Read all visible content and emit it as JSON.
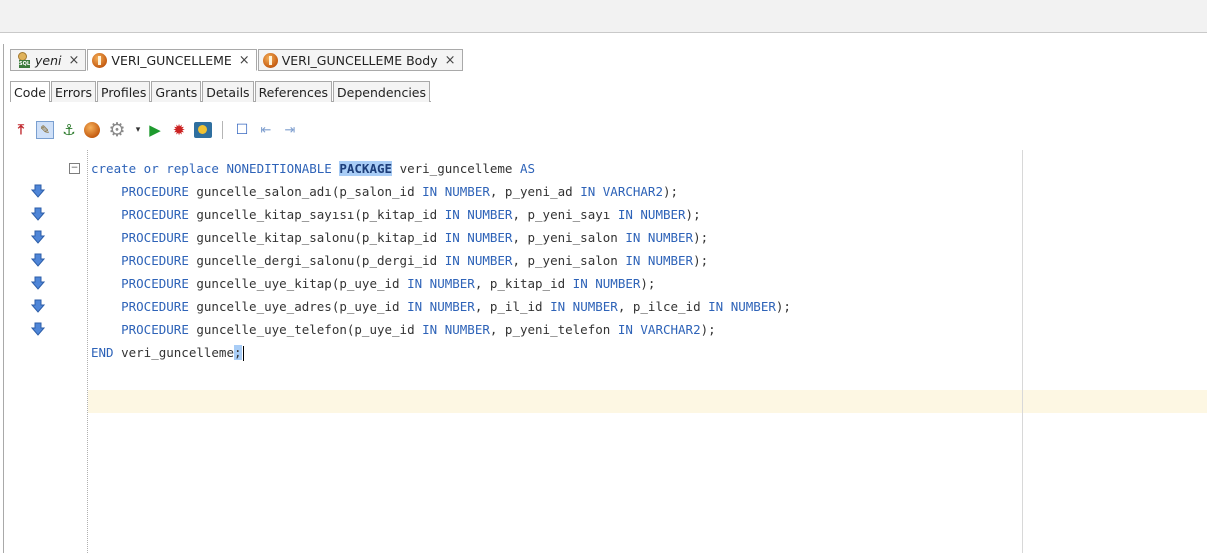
{
  "doc_tabs": [
    {
      "label": "yeni",
      "close": "×",
      "icon": "sql-worksheet-icon"
    },
    {
      "label": "VERI_GUNCELLEME",
      "close": "×",
      "icon": "package-icon"
    },
    {
      "label": "VERI_GUNCELLEME Body",
      "close": "×",
      "icon": "package-body-icon"
    }
  ],
  "sub_tabs": [
    "Code",
    "Errors",
    "Profiles",
    "Grants",
    "Details",
    "References",
    "Dependencies"
  ],
  "toolbar": {
    "icons": [
      "pin-icon",
      "edit-icon",
      "compile-icon",
      "package-icon",
      "gear-icon",
      "dropdown-icon",
      "run-icon",
      "debug-icon",
      "profile-icon",
      "bookmark-icon",
      "bookmark-prev-icon",
      "bookmark-next-icon"
    ]
  },
  "editor": {
    "fold_marker": "−",
    "lines": [
      {
        "indent": "",
        "tokens": [
          [
            "kw",
            "create or replace NONEDITIONABLE "
          ],
          [
            "hl",
            "PACKAGE"
          ],
          [
            "t",
            " veri_guncelleme "
          ],
          [
            "kw",
            "AS"
          ]
        ]
      },
      {
        "indent": "    ",
        "tokens": [
          [
            "kw",
            "PROCEDURE"
          ],
          [
            "t",
            " guncelle_salon_adı(p_salon_id "
          ],
          [
            "kw",
            "IN NUMBER"
          ],
          [
            "t",
            ", p_yeni_ad "
          ],
          [
            "kw",
            "IN VARCHAR2"
          ],
          [
            "t",
            ");"
          ]
        ]
      },
      {
        "indent": "    ",
        "tokens": [
          [
            "kw",
            "PROCEDURE"
          ],
          [
            "t",
            " guncelle_kitap_sayısı(p_kitap_id "
          ],
          [
            "kw",
            "IN NUMBER"
          ],
          [
            "t",
            ", p_yeni_sayı "
          ],
          [
            "kw",
            "IN NUMBER"
          ],
          [
            "t",
            ");"
          ]
        ]
      },
      {
        "indent": "    ",
        "tokens": [
          [
            "kw",
            "PROCEDURE"
          ],
          [
            "t",
            " guncelle_kitap_salonu(p_kitap_id "
          ],
          [
            "kw",
            "IN NUMBER"
          ],
          [
            "t",
            ", p_yeni_salon "
          ],
          [
            "kw",
            "IN NUMBER"
          ],
          [
            "t",
            ");"
          ]
        ]
      },
      {
        "indent": "    ",
        "tokens": [
          [
            "kw",
            "PROCEDURE"
          ],
          [
            "t",
            " guncelle_dergi_salonu(p_dergi_id "
          ],
          [
            "kw",
            "IN NUMBER"
          ],
          [
            "t",
            ", p_yeni_salon "
          ],
          [
            "kw",
            "IN NUMBER"
          ],
          [
            "t",
            ");"
          ]
        ]
      },
      {
        "indent": "    ",
        "tokens": [
          [
            "kw",
            "PROCEDURE"
          ],
          [
            "t",
            " guncelle_uye_kitap(p_uye_id "
          ],
          [
            "kw",
            "IN NUMBER"
          ],
          [
            "t",
            ", p_kitap_id "
          ],
          [
            "kw",
            "IN NUMBER"
          ],
          [
            "t",
            ");"
          ]
        ]
      },
      {
        "indent": "    ",
        "tokens": [
          [
            "kw",
            "PROCEDURE"
          ],
          [
            "t",
            " guncelle_uye_adres(p_uye_id "
          ],
          [
            "kw",
            "IN NUMBER"
          ],
          [
            "t",
            ", p_il_id "
          ],
          [
            "kw",
            "IN NUMBER"
          ],
          [
            "t",
            ", p_ilce_id "
          ],
          [
            "kw",
            "IN NUMBER"
          ],
          [
            "t",
            ");"
          ]
        ]
      },
      {
        "indent": "    ",
        "tokens": [
          [
            "kw",
            "PROCEDURE"
          ],
          [
            "t",
            " guncelle_uye_telefon(p_uye_id "
          ],
          [
            "kw",
            "IN NUMBER"
          ],
          [
            "t",
            ", p_yeni_telefon "
          ],
          [
            "kw",
            "IN VARCHAR2"
          ],
          [
            "t",
            ");"
          ]
        ]
      },
      {
        "indent": "",
        "tokens": [
          [
            "kw",
            "END"
          ],
          [
            "t",
            " veri_guncelleme"
          ],
          [
            "caret",
            ";"
          ]
        ]
      }
    ],
    "overview_arrow_icon": "implementation-arrow-icon"
  }
}
